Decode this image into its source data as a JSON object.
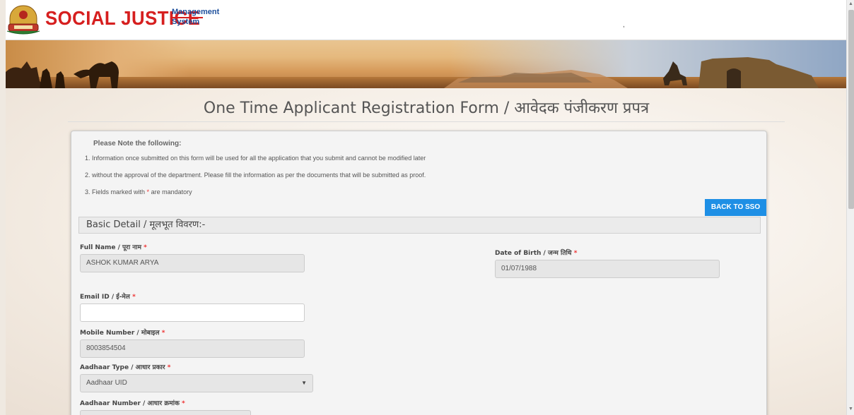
{
  "header": {
    "brand": "SOCIAL JUSTICE",
    "brand_sub_1": "Management",
    "brand_sub_2": "System",
    "dot": ","
  },
  "page": {
    "title": "One Time Applicant Registration Form / आवेदक पंजीकरण प्रपत्र"
  },
  "notes": {
    "heading": "Please Note the following:",
    "line1": "1. Information once submitted on this form will be used for all the application that you submit and cannot be modified later",
    "line2": "2. without the approval of the department. Please fill the information as per the documents that will be submitted as proof.",
    "line3_prefix": "3. Fields marked with",
    "line3_star": "*",
    "line3_suffix": "are mandatory"
  },
  "actions": {
    "back_label": "BACK TO SSO"
  },
  "section": {
    "basic_detail": "Basic Detail / मूलभूत विवरण:-"
  },
  "form": {
    "full_name_label": "Full Name / पूरा नाम",
    "full_name_value": "ASHOK KUMAR ARYA",
    "dob_label": "Date of Birth / जन्म तिथि",
    "dob_value": "01/07/1988",
    "email_label": "Email ID / ई-मेल",
    "email_value": "",
    "mobile_label": "Mobile Number / मोबाइल",
    "mobile_value": "8003854504",
    "aadhaar_type_label": "Aadhaar Type / आधार प्रकार",
    "aadhaar_type_value": "Aadhaar UID",
    "aadhaar_number_label": "Aadhaar Number / आधार क्रमांक",
    "required_mark": "*"
  },
  "colors": {
    "brand_red": "#d61f1f",
    "brand_blue": "#1d4f9c",
    "button_blue": "#1e8fe5"
  }
}
